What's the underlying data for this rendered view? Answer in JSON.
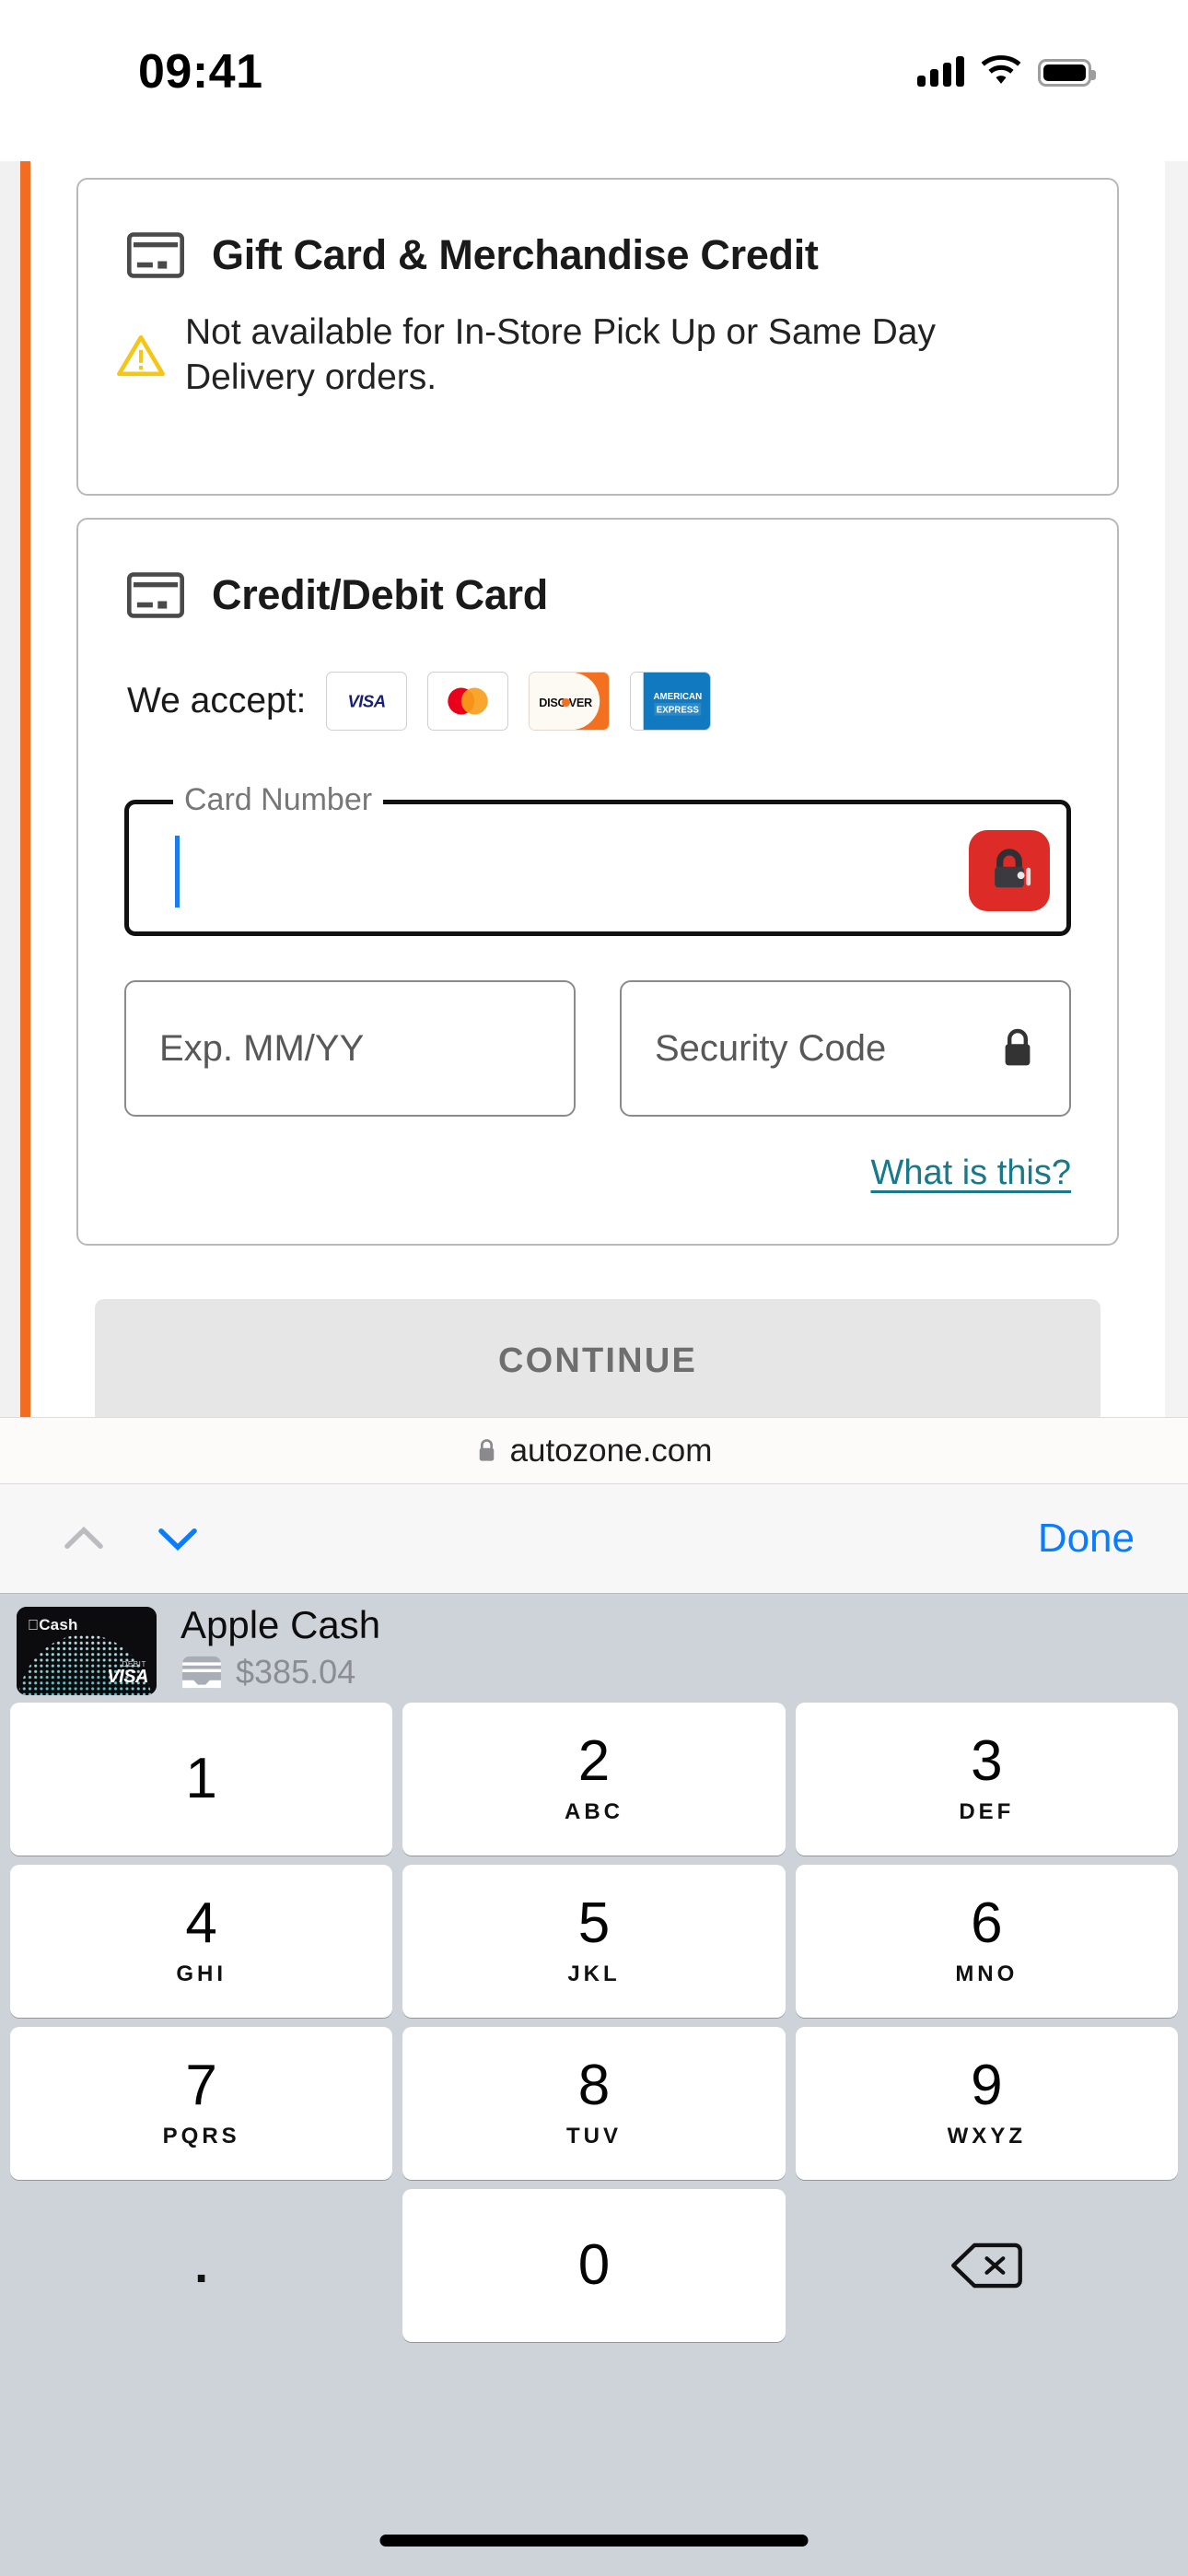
{
  "status_bar": {
    "time": "09:41",
    "icons": [
      "cellular-signal-icon",
      "wifi-icon",
      "battery-icon"
    ]
  },
  "browser": {
    "url": "autozone.com",
    "lock_icon": "lock-icon"
  },
  "page": {
    "accent_color": "#f26c21",
    "gift_card_section": {
      "icon": "credit-card-icon",
      "title": "Gift Card & Merchandise Credit",
      "warning_icon": "warning-triangle-icon",
      "warning_text": "Not available for In-Store Pick Up or Same Day Delivery orders."
    },
    "credit_card_section": {
      "icon": "credit-card-icon",
      "title": "Credit/Debit Card",
      "accept_label": "We accept:",
      "accepted_cards": [
        {
          "name": "visa",
          "label": "VISA"
        },
        {
          "name": "mastercard",
          "label": "Mastercard"
        },
        {
          "name": "discover",
          "label": "DISCOVER"
        },
        {
          "name": "amex",
          "label": "AMERICAN EXPRESS"
        }
      ],
      "card_number_field": {
        "label": "Card Number",
        "value": "",
        "focused": true,
        "password_manager_icon": "red-lock-badge-icon"
      },
      "expiry_field": {
        "placeholder": "Exp. MM/YY",
        "value": ""
      },
      "security_code_field": {
        "placeholder": "Security Code",
        "value": "",
        "icon": "lock-icon"
      },
      "help_link": "What is this?"
    },
    "continue_button": "CONTINUE"
  },
  "keyboard_toolbar": {
    "previous_icon": "chevron-up-icon",
    "next_icon": "chevron-down-icon",
    "done_label": "Done"
  },
  "autofill_suggestion": {
    "card_art_label": "Cash",
    "card_art_network": "VISA",
    "card_art_type": "DEBIT",
    "title": "Apple Cash",
    "wallet_icon": "wallet-icon",
    "balance": "$385.04"
  },
  "keypad": {
    "rows": [
      [
        {
          "num": "1",
          "sub": ""
        },
        {
          "num": "2",
          "sub": "ABC"
        },
        {
          "num": "3",
          "sub": "DEF"
        }
      ],
      [
        {
          "num": "4",
          "sub": "GHI"
        },
        {
          "num": "5",
          "sub": "JKL"
        },
        {
          "num": "6",
          "sub": "MNO"
        }
      ],
      [
        {
          "num": "7",
          "sub": "PQRS"
        },
        {
          "num": "8",
          "sub": "TUV"
        },
        {
          "num": "9",
          "sub": "WXYZ"
        }
      ]
    ],
    "period_key": ".",
    "zero_key": "0",
    "delete_icon": "delete-backspace-icon"
  }
}
